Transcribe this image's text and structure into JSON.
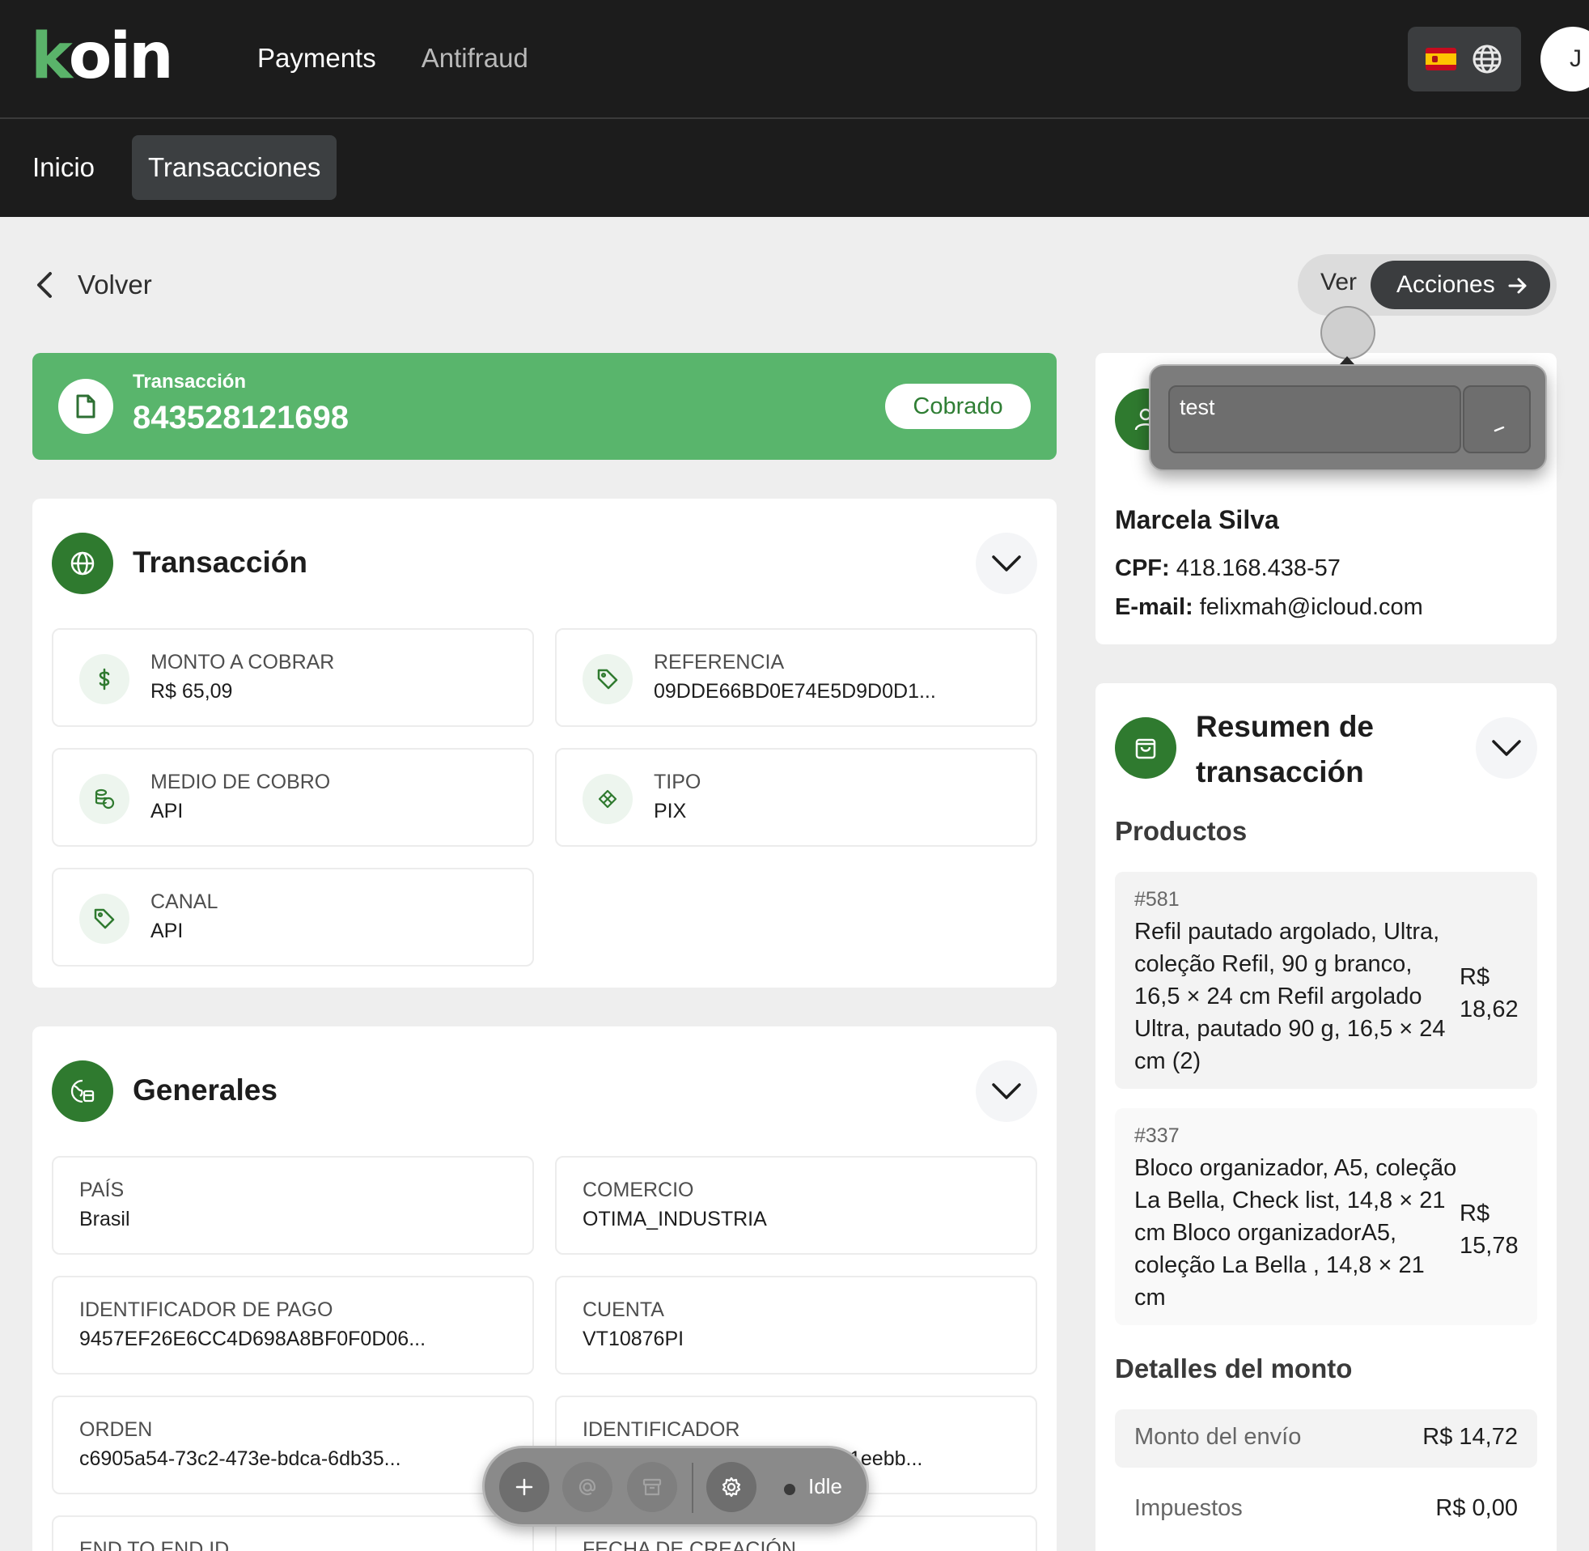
{
  "app": {
    "logo": "koin",
    "top_nav": [
      "Payments",
      "Antifraud"
    ],
    "user_initial": "J"
  },
  "sub_nav": {
    "home": "Inicio",
    "transactions": "Transacciones"
  },
  "page": {
    "back_label": "Volver",
    "view_label": "Ver",
    "actions_label": "Acciones"
  },
  "banner": {
    "label": "Transacción",
    "number": "843528121698",
    "status": "Cobrado"
  },
  "transaction_card": {
    "title": "Transacción",
    "fields": [
      {
        "label": "MONTO A COBRAR",
        "value": "R$ 65,09",
        "icon": "dollar-icon"
      },
      {
        "label": "REFERENCIA",
        "value": "09DDE66BD0E74E5D9D0D1...",
        "icon": "tag-icon"
      },
      {
        "label": "MEDIO DE COBRO",
        "value": "API",
        "icon": "coins-icon"
      },
      {
        "label": "TIPO",
        "value": "PIX",
        "icon": "pix-icon"
      },
      {
        "label": "CANAL",
        "value": "API",
        "icon": "tag-icon"
      }
    ]
  },
  "general_card": {
    "title": "Generales",
    "fields": [
      {
        "label": "PAÍS",
        "value": "Brasil"
      },
      {
        "label": "COMERCIO",
        "value": "OTIMA_INDUSTRIA"
      },
      {
        "label": "IDENTIFICADOR DE PAGO",
        "value": "9457EF26E6CC4D698A8BF0F0D06..."
      },
      {
        "label": "CUENTA",
        "value": "VT10876PI"
      },
      {
        "label": "ORDEN",
        "value": "c6905a54-73c2-473e-bdca-6db35..."
      },
      {
        "label": "IDENTIFICADOR",
        "value": "1eebb..."
      },
      {
        "label": "END TO END ID",
        "value": ""
      },
      {
        "label": "FECHA DE CREACIÓN",
        "value": ""
      }
    ]
  },
  "popover": {
    "input_value": "test"
  },
  "customer": {
    "name": "Marcela Silva",
    "cpf_label": "CPF:",
    "cpf": "418.168.438-57",
    "email_label": "E-mail:",
    "email": "felixmah@icloud.com"
  },
  "summary": {
    "title_line1": "Resumen de",
    "title_line2": "transacción",
    "products_title": "Productos",
    "products": [
      {
        "id": "#581",
        "description": "Refil pautado argolado, Ultra, coleção Refil, 90 g branco, 16,5 × 24 cm Refil argolado Ultra, pautado 90 g, 16,5 × 24 cm (2)",
        "price_currency": "R$",
        "price_value": "18,62"
      },
      {
        "id": "#337",
        "description": "Bloco organizador, A5, coleção La Bella, Check list, 14,8 × 21 cm Bloco organizadorA5, coleção La Bella , 14,8 × 21 cm",
        "price_currency": "R$",
        "price_value": "15,78"
      }
    ],
    "amount_title": "Detalles del monto",
    "amounts": [
      {
        "label": "Monto del envío",
        "value": "R$ 14,72"
      },
      {
        "label": "Impuestos",
        "value": "R$ 0,00"
      }
    ]
  },
  "toolbar": {
    "status": "Idle"
  },
  "colors": {
    "brand_green": "#59b56c",
    "dark_green": "#2f7a2f",
    "header_bg": "#1c1c1c"
  }
}
